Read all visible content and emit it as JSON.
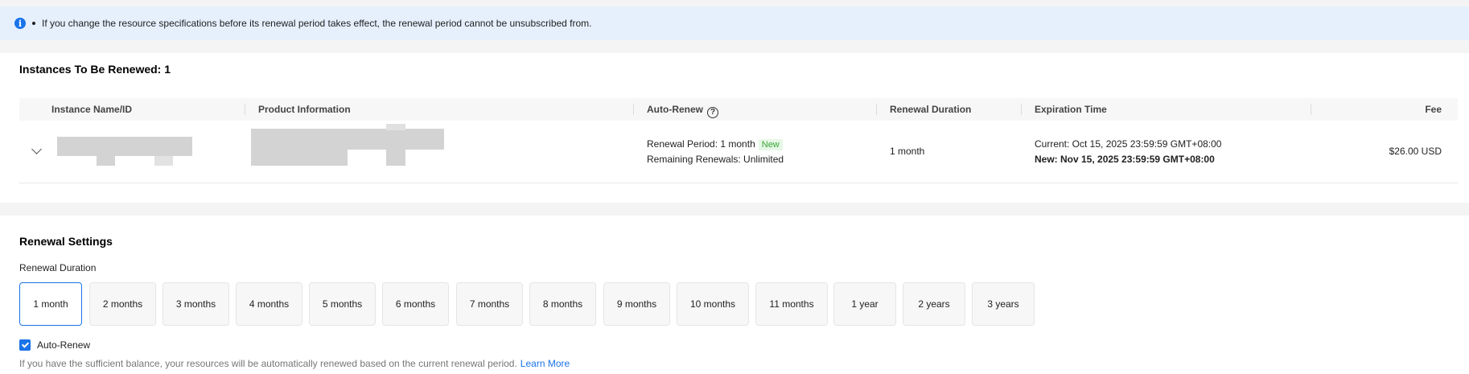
{
  "notice": {
    "text": "If you change the resource specifications before its renewal period takes effect, the renewal period cannot be unsubscribed from."
  },
  "instances": {
    "title": "Instances To Be Renewed: 1",
    "columns": {
      "name": "Instance Name/ID",
      "product": "Product Information",
      "auto_renew": "Auto-Renew",
      "duration": "Renewal Duration",
      "expiration": "Expiration Time",
      "fee": "Fee"
    },
    "rows": [
      {
        "renewal_period": "Renewal Period: 1 month",
        "new_tag": "New",
        "remaining": "Remaining Renewals: Unlimited",
        "duration": "1 month",
        "current": "Current: Oct 15, 2025 23:59:59 GMT+08:00",
        "new_expiration": "New: Nov 15, 2025 23:59:59 GMT+08:00",
        "fee": "$26.00 USD"
      }
    ]
  },
  "settings": {
    "title": "Renewal Settings",
    "duration_label": "Renewal Duration",
    "durations": [
      "1 month",
      "2 months",
      "3 months",
      "4 months",
      "5 months",
      "6 months",
      "7 months",
      "8 months",
      "9 months",
      "10 months",
      "11 months",
      "1 year",
      "2 years",
      "3 years"
    ],
    "selected": "1 month",
    "auto_renew_label": "Auto-Renew",
    "auto_renew_checked": true,
    "note": "If you have the sufficient balance, your resources will be automatically renewed based on the current renewal period.",
    "learn_more": "Learn More"
  },
  "colors": {
    "accent": "#1a73e8",
    "notice_bg": "#e6f0fd",
    "new_tag": "#3aa53a"
  },
  "icons": {
    "notice": "info-icon",
    "auto_renew_help": "question-circle-icon",
    "row_toggle": "chevron-down-icon",
    "checkbox": "check-icon"
  }
}
